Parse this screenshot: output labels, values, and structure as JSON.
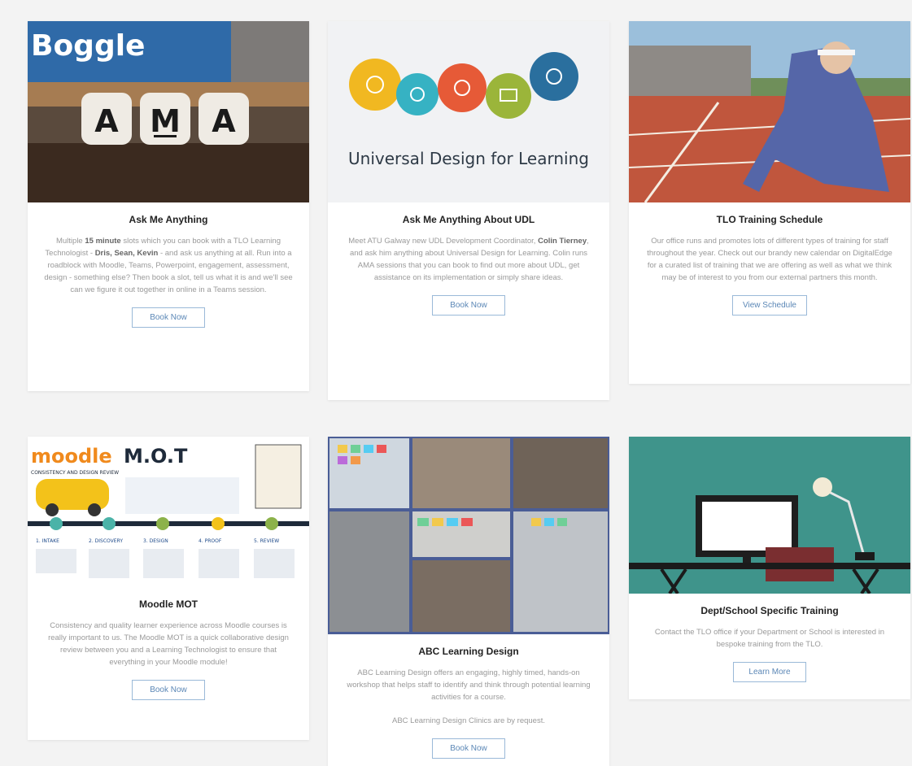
{
  "cards": [
    {
      "image": {
        "badge": "Boggle",
        "tiles": [
          "A",
          "M",
          "A"
        ]
      },
      "title": "Ask Me Anything",
      "desc_before": "Multiple ",
      "desc_bold1": "15 minute",
      "desc_mid": " slots which you can book with a TLO Learning Technologist - ",
      "desc_bold2": "Dris, Sean, Kevin",
      "desc_after": " - and ask us anything at all. Run into a roadblock with Moodle, Teams, Powerpoint, engagement, assessment, design - something else? Then book a slot, tell us what it is and we'll see can we figure it out together in online in a Teams session.",
      "button": "Book Now"
    },
    {
      "image": {
        "caption": "Universal Design for Learning"
      },
      "title": "Ask Me Anything About UDL",
      "desc_before": "Meet ATU Galway new UDL Development Coordinator, ",
      "desc_bold1": "Colin Tierney",
      "desc_after": ", and ask him anything about Universal Design for Learning. Colin runs AMA sessions that you can book to find out more about UDL, get assistance on its implementation or simply share ideas.",
      "button": "Book Now"
    },
    {
      "image": {},
      "title": "TLO Training Schedule",
      "desc": "Our office runs and promotes lots of different types of training for staff throughout the year. Check out our brandy new calendar on DigitalEdge for a curated list of training that we are offering as well as what we think may be of interest to you from our external partners this month.",
      "button": "View Schedule"
    },
    {
      "image": {
        "logo_word": "moodle",
        "logo_rest": "M.O.T",
        "tagline": "CONSISTENCY AND DESIGN REVIEW",
        "steps": [
          "1. INTAKE",
          "2. DISCOVERY",
          "3. DESIGN",
          "4. PROOF",
          "5. REVIEW"
        ]
      },
      "title": "Moodle MOT",
      "desc": "Consistency and quality learner experience across Moodle courses is really important to us. The Moodle MOT is a quick collaborative design review between you and a Learning Technologist to ensure that everything in your Moodle module!",
      "button": "Book Now"
    },
    {
      "image": {},
      "title": "ABC Learning Design",
      "desc": "ABC Learning Design offers an engaging, highly timed, hands-on workshop that helps staff to identify and think through potential learning activities for a course.",
      "desc2": "ABC Learning Design Clinics are by request.",
      "button": "Book Now"
    },
    {
      "image": {},
      "title": "Dept/School Specific Training",
      "desc": "Contact the TLO office if your Department or School is interested in bespoke training from the TLO.",
      "button": "Learn More"
    }
  ]
}
